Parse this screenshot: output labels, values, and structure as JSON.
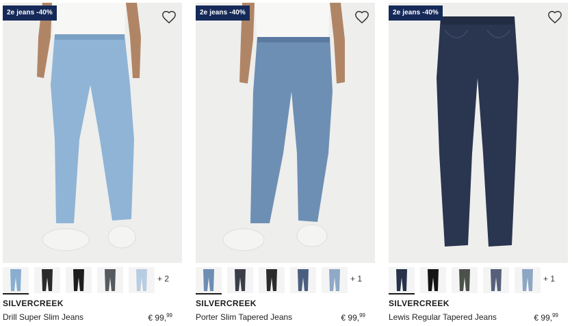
{
  "colors": {
    "badge": "#162a5a",
    "photo_bg": "#eeeeec"
  },
  "products": [
    {
      "badge": "2e jeans -40%",
      "brand": "SILVERCREEK",
      "name": "Drill Super Slim Jeans",
      "price_main": "€ 99,",
      "price_cents": "99",
      "more_colors": "+ 2",
      "jeans_color": "#8fb4d6",
      "swatches": [
        "#8aaed0",
        "#2a2a2a",
        "#1e1e1e",
        "#555a5e",
        "#b7cde2"
      ]
    },
    {
      "badge": "2e jeans -40%",
      "brand": "SILVERCREEK",
      "name": "Porter Slim Tapered Jeans",
      "price_main": "€ 99,",
      "price_cents": "99",
      "more_colors": "+ 1",
      "jeans_color": "#6e8fb4",
      "swatches": [
        "#6d8db2",
        "#3a3f47",
        "#2c2c2c",
        "#4a5f80",
        "#8fa9c7"
      ]
    },
    {
      "badge": "2e jeans -40%",
      "brand": "SILVERCREEK",
      "name": "Lewis Regular Tapered Jeans",
      "price_main": "€ 99,",
      "price_cents": "99",
      "more_colors": "+ 1",
      "jeans_color": "#2a3650",
      "swatches": [
        "#27324a",
        "#141414",
        "#4a524a",
        "#56607a",
        "#8ca7c4"
      ]
    }
  ]
}
